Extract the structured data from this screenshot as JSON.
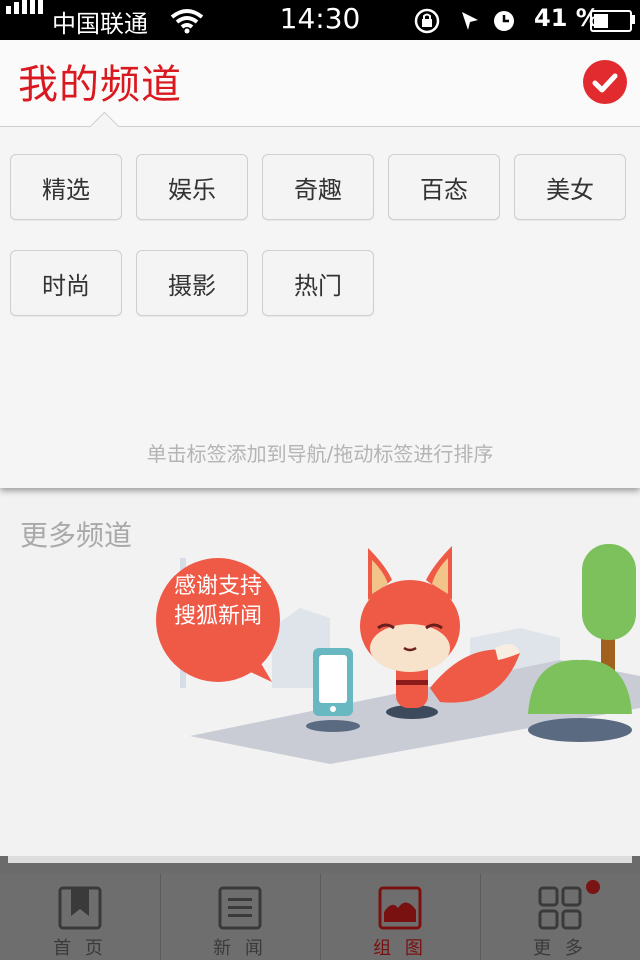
{
  "status_bar": {
    "carrier": "中国联通",
    "time": "14:30",
    "battery": "41 %"
  },
  "panel": {
    "title": "我的频道",
    "tags": [
      "精选",
      "娱乐",
      "奇趣",
      "百态",
      "美女",
      "时尚",
      "摄影",
      "热门"
    ],
    "hint": "单击标签添加到导航/拖动标签进行排序"
  },
  "more": {
    "title": "更多频道",
    "bubble_line1": "感谢支持",
    "bubble_line2": "搜狐新闻"
  },
  "tabs": [
    {
      "label": "首 页",
      "icon": "bookmark-icon",
      "active": false
    },
    {
      "label": "新 闻",
      "icon": "news-list-icon",
      "active": false
    },
    {
      "label": "组 图",
      "icon": "picture-icon",
      "active": true
    },
    {
      "label": "更 多",
      "icon": "grid-icon",
      "active": false
    }
  ],
  "colors": {
    "accent": "#d9181f",
    "confirm": "#e12b2e",
    "mascot": "#ef5a47"
  }
}
